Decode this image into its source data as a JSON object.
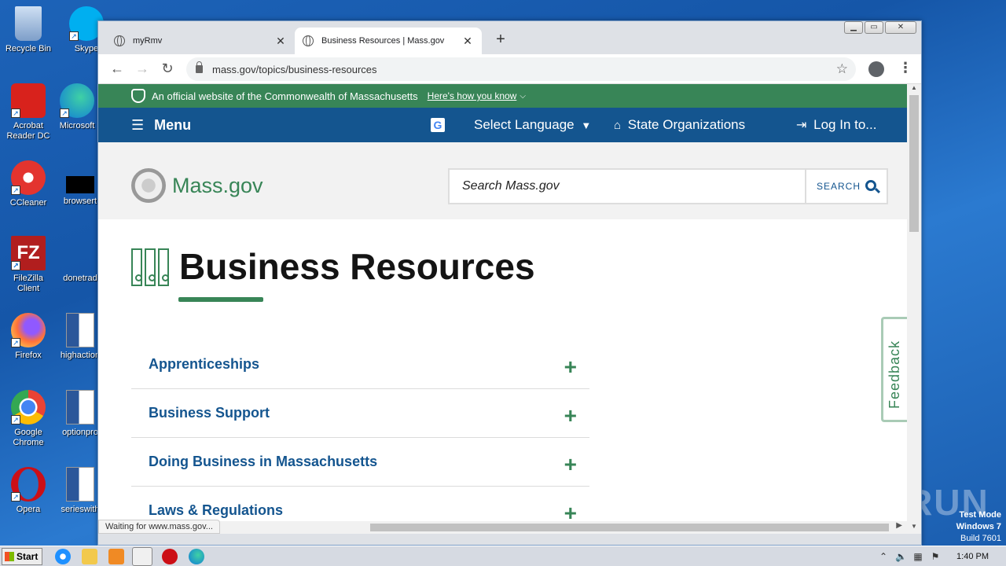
{
  "desktop": {
    "icons": [
      {
        "label": "Recycle Bin",
        "color": "#9bb7d9"
      },
      {
        "label": "Skype",
        "color": "#00aff0"
      },
      {
        "label": "Acrobat Reader DC",
        "color": "#d8221c"
      },
      {
        "label": "Microsoft",
        "color": "#0f7bd8"
      },
      {
        "label": "CCleaner",
        "color": "#e3342f"
      },
      {
        "label": "browsert",
        "color": "#000000"
      },
      {
        "label": "FileZilla Client",
        "color": "#b11e1e"
      },
      {
        "label": "donetrad",
        "color": "#ffffff"
      },
      {
        "label": "Firefox",
        "color": "#ff7139"
      },
      {
        "label": "highaction",
        "color": "#2b579a"
      },
      {
        "label": "Google Chrome",
        "color": "#4285f4"
      },
      {
        "label": "optionpro",
        "color": "#2b579a"
      },
      {
        "label": "Opera",
        "color": "#cc0f16"
      },
      {
        "label": "serieswith",
        "color": "#2b579a"
      }
    ],
    "watermark": "ANY RUN",
    "test_mode": {
      "line1": "Test Mode",
      "line2": "Windows 7",
      "line3": "Build 7601"
    }
  },
  "browser": {
    "tabs": [
      {
        "title": "myRmv",
        "close": "✕"
      },
      {
        "title": "Business Resources | Mass.gov",
        "close": "✕"
      }
    ],
    "new_tab": "+",
    "url": "mass.gov/topics/business-resources",
    "status": "Waiting for www.mass.gov...",
    "controls": {
      "back": "←",
      "forward": "→",
      "reload": "↻",
      "bookmark": "☆",
      "menu": "⋮"
    }
  },
  "site": {
    "banner": {
      "text": "An official website of the Commonwealth of Massachusetts",
      "link": "Here's how you know"
    },
    "nav": {
      "menu": "Menu",
      "language": "Select Language",
      "orgs": "State Organizations",
      "login": "Log In to..."
    },
    "logo": "Mass.gov",
    "search": {
      "placeholder": "Search Mass.gov",
      "button": "SEARCH"
    },
    "page_title": "Business Resources",
    "accordion": [
      {
        "label": "Apprenticeships"
      },
      {
        "label": "Business Support"
      },
      {
        "label": "Doing Business in Massachusetts"
      },
      {
        "label": "Laws & Regulations"
      }
    ],
    "feedback": "Feedback",
    "colors": {
      "green": "#388557",
      "blue": "#14558f"
    }
  },
  "taskbar": {
    "start": "Start",
    "clock": "1:40 PM"
  }
}
